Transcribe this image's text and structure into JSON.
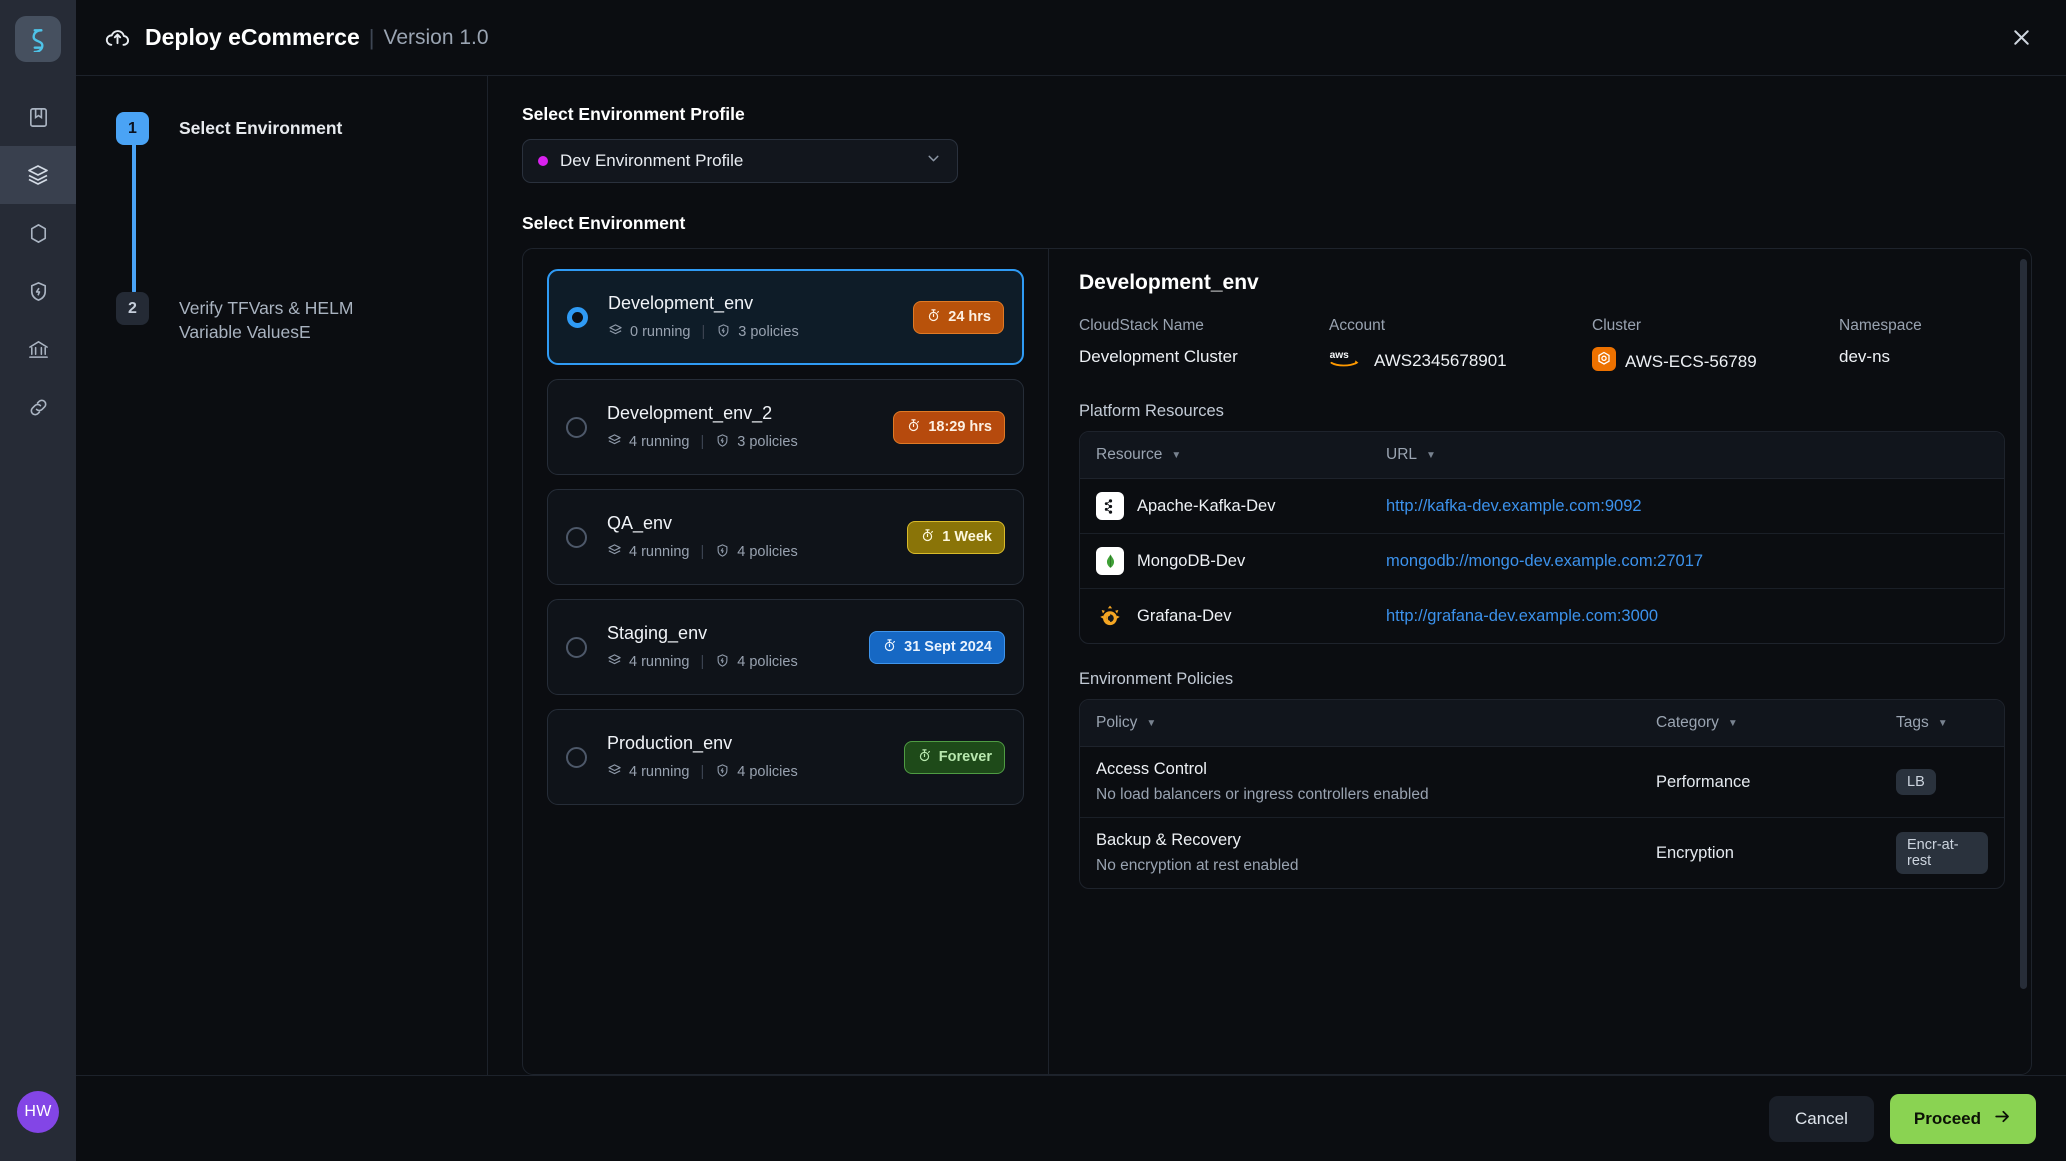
{
  "rail": {
    "logo_icon": "app-logo-icon",
    "items": [
      {
        "icon": "book-icon",
        "active": false
      },
      {
        "icon": "layers-icon",
        "active": true
      },
      {
        "icon": "hexagon-icon",
        "active": false
      },
      {
        "icon": "shield-bolt-icon",
        "active": false
      },
      {
        "icon": "bank-icon",
        "active": false
      },
      {
        "icon": "link-icon",
        "active": false
      }
    ],
    "avatar_initials": "HW"
  },
  "header": {
    "icon": "cloud-upload-icon",
    "title": "Deploy eCommerce",
    "separator": "|",
    "version": "Version 1.0",
    "close_icon": "close-icon"
  },
  "steps": [
    {
      "number": "1",
      "label": "Select Environment",
      "state": "active"
    },
    {
      "number": "2",
      "label": "Verify TFVars & HELM  Variable ValuesE",
      "state": "pending"
    }
  ],
  "profile": {
    "label": "Select Environment Profile",
    "selected": "Dev Environment Profile",
    "dot_color": "#d921ef",
    "caret_icon": "chevron-down-icon"
  },
  "environment_section_label": "Select Environment",
  "environments": [
    {
      "name": "Development_env",
      "running": "0 running",
      "policies": "3 policies",
      "badge": "24 hrs",
      "badge_style": "tb-orange",
      "selected": true
    },
    {
      "name": "Development_env_2",
      "running": "4 running",
      "policies": "3 policies",
      "badge": "18:29 hrs",
      "badge_style": "tb-orange2",
      "selected": false
    },
    {
      "name": "QA_env",
      "running": "4 running",
      "policies": "4 policies",
      "badge": "1 Week",
      "badge_style": "tb-yellow",
      "selected": false
    },
    {
      "name": "Staging_env",
      "running": "4 running",
      "policies": "4 policies",
      "badge": "31 Sept 2024",
      "badge_style": "tb-blue",
      "selected": false
    },
    {
      "name": "Production_env",
      "running": "4 running",
      "policies": "4 policies",
      "badge": "Forever",
      "badge_style": "tb-green",
      "selected": false
    }
  ],
  "details": {
    "title": "Development_env",
    "facts": [
      {
        "label": "CloudStack Name",
        "value": "Development Cluster",
        "icon": ""
      },
      {
        "label": "Account",
        "value": "AWS2345678901",
        "icon": "aws-icon"
      },
      {
        "label": "Cluster",
        "value": "AWS-ECS-56789",
        "icon": "ecs-icon"
      },
      {
        "label": "Namespace",
        "value": "dev-ns",
        "icon": ""
      }
    ],
    "resources_heading": "Platform Resources",
    "resources_columns": [
      "Resource",
      "URL"
    ],
    "resources": [
      {
        "icon": "kafka-icon",
        "name": "Apache-Kafka-Dev",
        "url": "http://kafka-dev.example.com:9092"
      },
      {
        "icon": "mongodb-icon",
        "name": "MongoDB-Dev",
        "url": "mongodb://mongo-dev.example.com:27017"
      },
      {
        "icon": "grafana-icon",
        "name": "Grafana-Dev",
        "url": "http://grafana-dev.example.com:3000"
      }
    ],
    "policies_heading": "Environment Policies",
    "policies_columns": [
      "Policy",
      "Category",
      "Tags"
    ],
    "policies": [
      {
        "name": "Access Control",
        "description": "No load balancers or ingress controllers enabled",
        "category": "Performance",
        "tag": "LB"
      },
      {
        "name": "Backup & Recovery",
        "description": "No encryption at rest enabled",
        "category": "Encryption",
        "tag": "Encr-at-rest"
      }
    ]
  },
  "footer": {
    "cancel_label": "Cancel",
    "proceed_label": "Proceed",
    "proceed_icon": "arrow-right-icon"
  }
}
